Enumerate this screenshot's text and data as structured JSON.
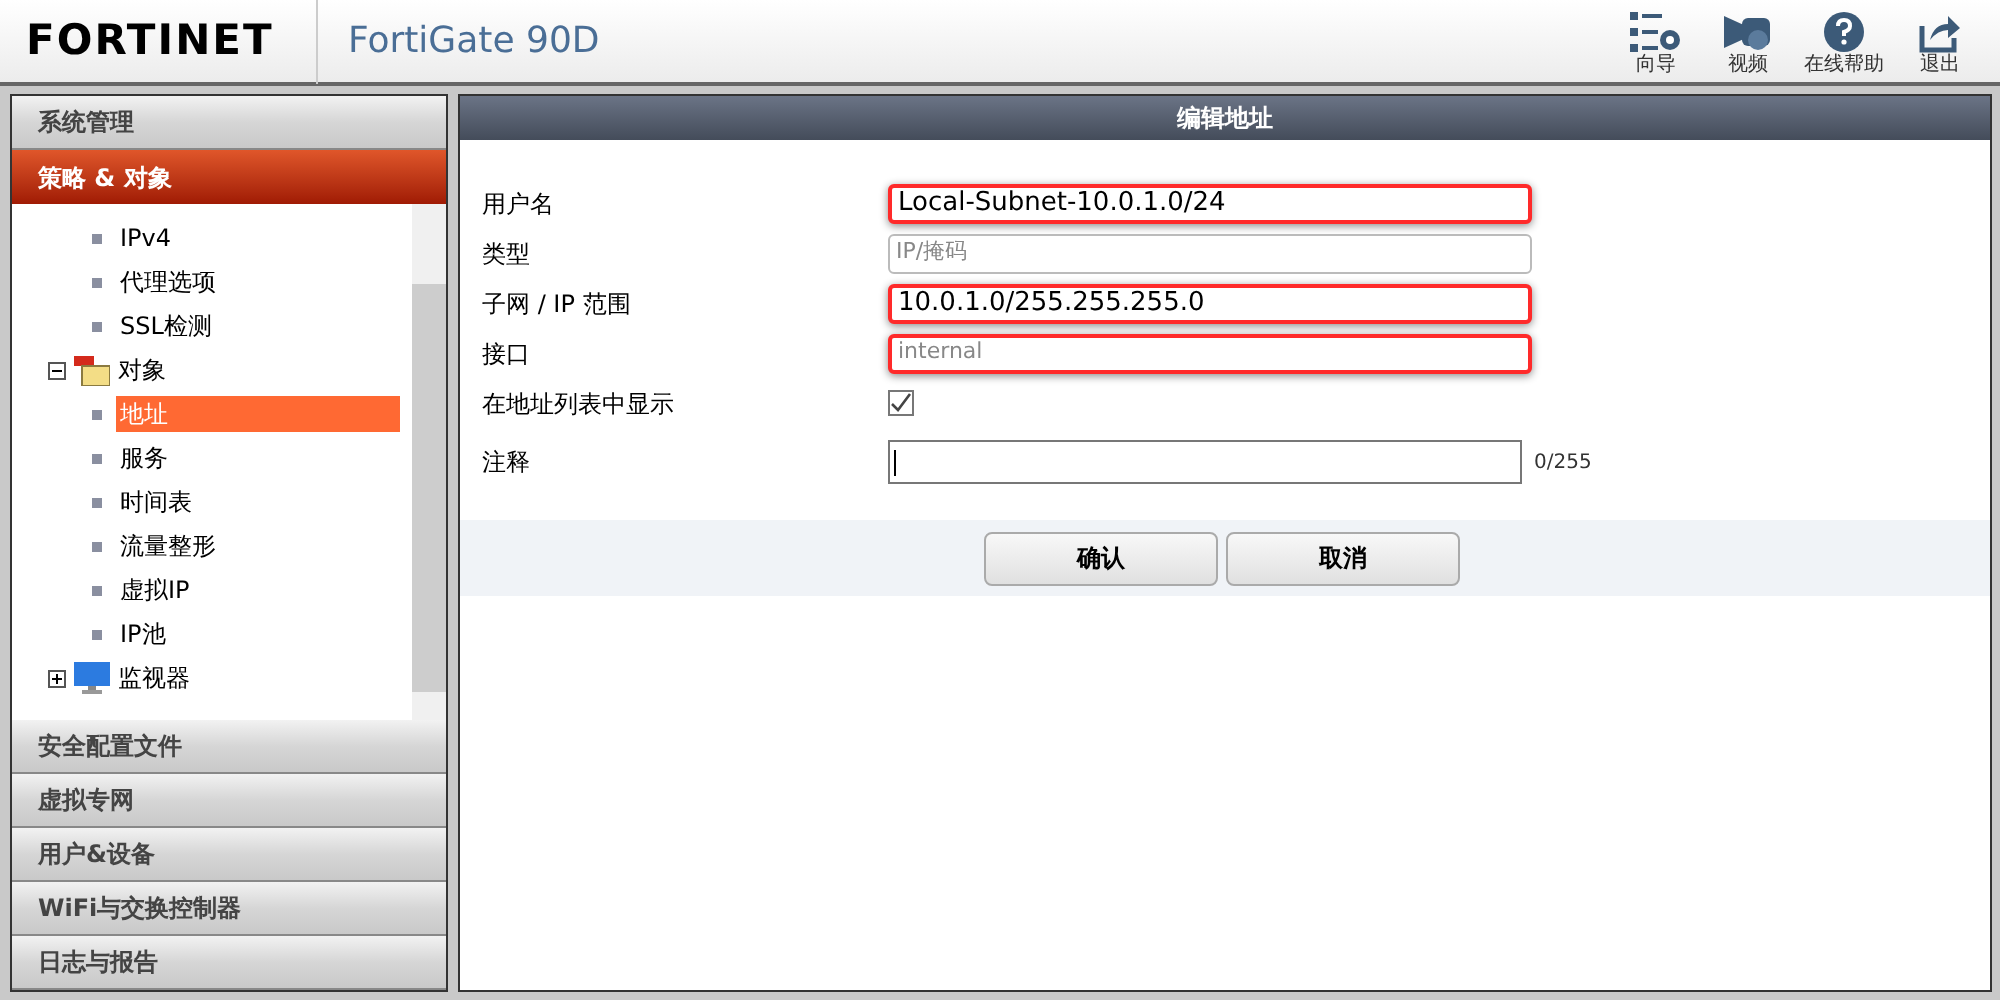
{
  "header": {
    "logo": "FORTINET",
    "product": "FortiGate 90D",
    "toolbar": [
      {
        "label": "向导",
        "kind": "wizard"
      },
      {
        "label": "视频",
        "kind": "video"
      },
      {
        "label": "在线帮助",
        "kind": "help"
      },
      {
        "label": "退出",
        "kind": "logout"
      }
    ]
  },
  "sidebar": {
    "sections_top": [
      {
        "label": "系统管理",
        "selected": false
      },
      {
        "label": "策略 & 对象",
        "selected": true
      }
    ],
    "tree": [
      {
        "label": "IPv4",
        "kind": "leaf",
        "selected": false
      },
      {
        "label": "代理选项",
        "kind": "leaf",
        "selected": false
      },
      {
        "label": "SSL检测",
        "kind": "leaf",
        "selected": false
      },
      {
        "label": "对象",
        "kind": "folder",
        "expanded": true,
        "children": [
          {
            "label": "地址",
            "kind": "leaf",
            "selected": true
          },
          {
            "label": "服务",
            "kind": "leaf",
            "selected": false
          },
          {
            "label": "时间表",
            "kind": "leaf",
            "selected": false
          },
          {
            "label": "流量整形",
            "kind": "leaf",
            "selected": false
          },
          {
            "label": "虚拟IP",
            "kind": "leaf",
            "selected": false
          },
          {
            "label": "IP池",
            "kind": "leaf",
            "selected": false
          }
        ]
      },
      {
        "label": "监视器",
        "kind": "monitor",
        "expanded": false
      }
    ],
    "sections_bottom": [
      {
        "label": "安全配置文件",
        "selected": false
      },
      {
        "label": "虚拟专网",
        "selected": false
      },
      {
        "label": "用户&设备",
        "selected": false
      },
      {
        "label": "WiFi与交换控制器",
        "selected": false
      },
      {
        "label": "日志与报告",
        "selected": false
      }
    ]
  },
  "form": {
    "title": "编辑地址",
    "fields": [
      {
        "label": "用户名",
        "kind": "text",
        "value": "Local-Subnet-10.0.1.0/24",
        "disabled": false,
        "highlighted": true
      },
      {
        "label": "类型",
        "kind": "text",
        "value": "IP/掩码",
        "disabled": true,
        "highlighted": false
      },
      {
        "label": "子网 / IP 范围",
        "kind": "text",
        "value": "10.0.1.0/255.255.255.0",
        "disabled": false,
        "highlighted": true
      },
      {
        "label": "接口",
        "kind": "text",
        "value": "internal",
        "disabled": true,
        "highlighted": true
      },
      {
        "label": "在地址列表中显示",
        "kind": "checkbox",
        "checked": true
      },
      {
        "label": "注释",
        "kind": "textarea",
        "counter": "0/255"
      }
    ],
    "buttons": [
      "确认",
      "取消"
    ]
  }
}
